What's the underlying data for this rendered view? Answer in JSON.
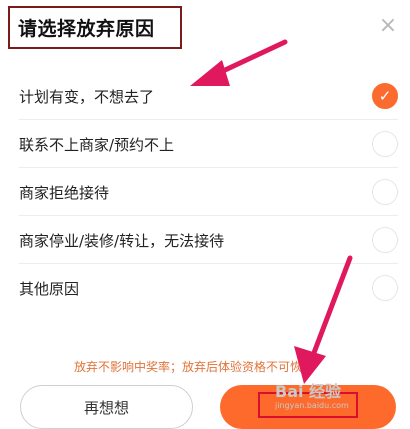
{
  "dialog": {
    "title": "请选择放弃原因",
    "close_icon": "×",
    "options": [
      {
        "label": "计划有变，不想去了",
        "checked": true,
        "check_mark": "✓"
      },
      {
        "label": "联系不上商家/预约不上",
        "checked": false
      },
      {
        "label": "商家拒绝接待",
        "checked": false
      },
      {
        "label": "商家停业/装修/转让，无法接待",
        "checked": false
      },
      {
        "label": "其他原因",
        "checked": false
      }
    ],
    "notice": "放弃不影响中奖率；放弃后体验资格不可恢复",
    "buttons": {
      "rethink": "再想想",
      "confirm": ""
    }
  },
  "watermark": {
    "brand": "Bai 经验",
    "url": "jingyan.baidu.com"
  },
  "colors": {
    "accent": "#fd6a2b",
    "annotation": "#e0195f",
    "highlight_box": "#d90f2f",
    "title_box": "#7a1c1c"
  }
}
